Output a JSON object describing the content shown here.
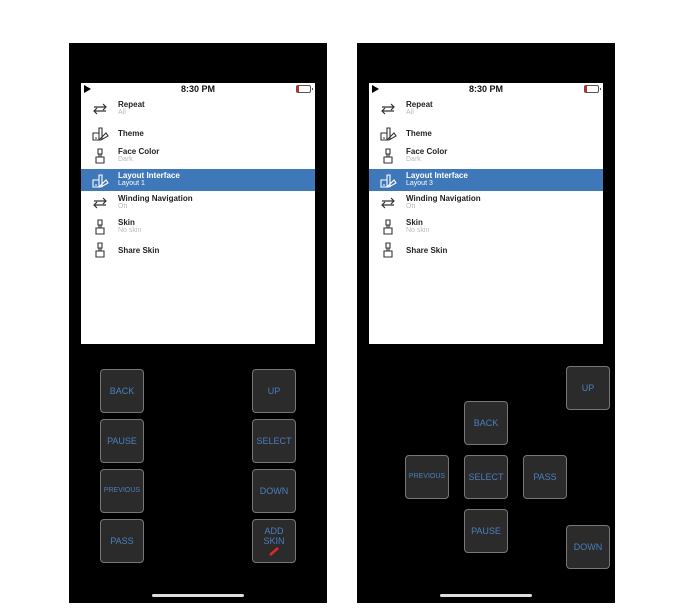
{
  "status": {
    "time": "8:30 PM"
  },
  "phones": [
    {
      "menu": [
        {
          "title": "Repeat",
          "subtitle": "All",
          "icon": "repeat-icon"
        },
        {
          "title": "Theme",
          "subtitle": "",
          "icon": "swatch-icon"
        },
        {
          "title": "Face Color",
          "subtitle": "Dark",
          "icon": "brush-icon"
        },
        {
          "title": "Layout Interface",
          "subtitle": "Layout 1",
          "icon": "swatch-icon",
          "selected": true
        },
        {
          "title": "Winding Navigation",
          "subtitle": "On",
          "icon": "repeat-icon"
        },
        {
          "title": "Skin",
          "subtitle": "No skin",
          "icon": "brush-icon"
        },
        {
          "title": "Share Skin",
          "subtitle": "",
          "icon": "brush-icon"
        }
      ],
      "buttons": {
        "back": "BACK",
        "pause": "PAUSE",
        "previous": "PREVIOUS",
        "pass": "PASS",
        "up": "UP",
        "select": "SELECT",
        "down": "DOWN",
        "add_skin_1": "ADD",
        "add_skin_2": "SKIN"
      }
    },
    {
      "menu": [
        {
          "title": "Repeat",
          "subtitle": "All",
          "icon": "repeat-icon"
        },
        {
          "title": "Theme",
          "subtitle": "",
          "icon": "swatch-icon"
        },
        {
          "title": "Face Color",
          "subtitle": "Dark",
          "icon": "brush-icon"
        },
        {
          "title": "Layout Interface",
          "subtitle": "Layout 3",
          "icon": "swatch-icon",
          "selected": true
        },
        {
          "title": "Winding Navigation",
          "subtitle": "On",
          "icon": "repeat-icon"
        },
        {
          "title": "Skin",
          "subtitle": "No skin",
          "icon": "brush-icon"
        },
        {
          "title": "Share Skin",
          "subtitle": "",
          "icon": "brush-icon"
        }
      ],
      "buttons": {
        "up": "UP",
        "back": "BACK",
        "previous": "PREVIOUS",
        "select": "SELECT",
        "pass": "PASS",
        "pause": "PAUSE",
        "down": "DOWN"
      }
    }
  ],
  "colors": {
    "accent": "#3f78b8",
    "button_text": "#4a7fc0",
    "button_bg": "#2b2b2b"
  }
}
